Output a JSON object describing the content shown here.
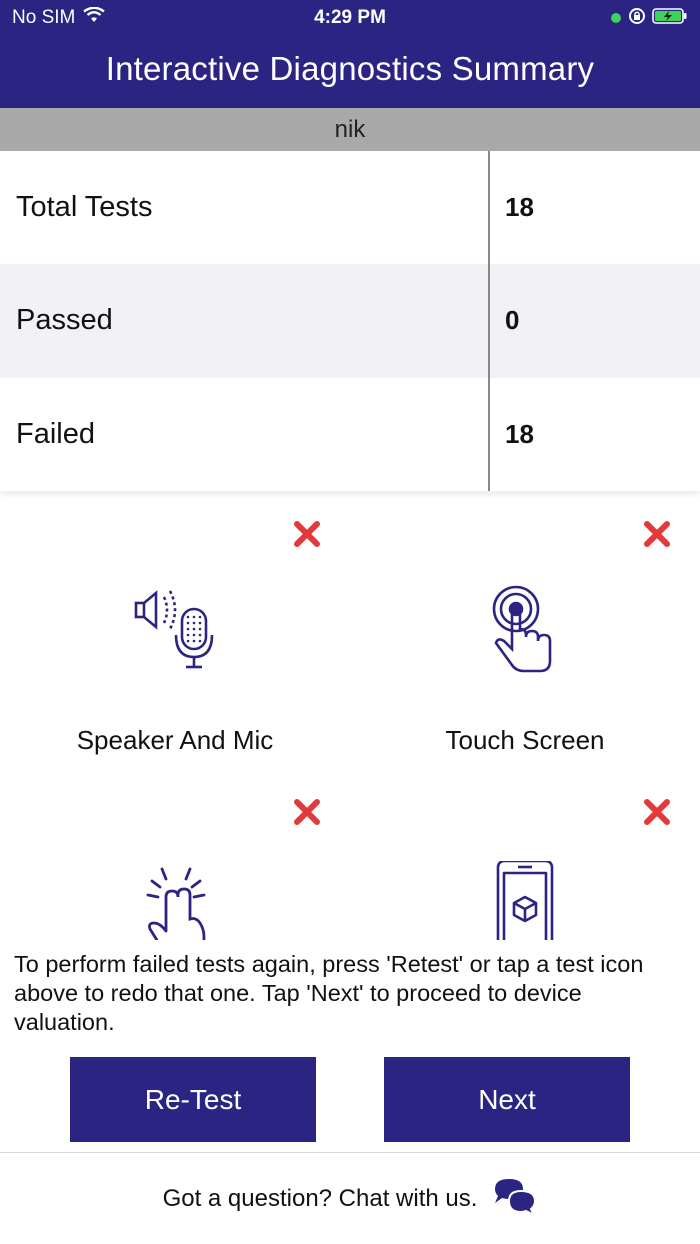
{
  "status_bar": {
    "carrier": "No SIM",
    "time": "4:29 PM"
  },
  "header": {
    "title": "Interactive Diagnostics Summary"
  },
  "user": {
    "name": "nik"
  },
  "summary": {
    "rows": [
      {
        "label": "Total Tests",
        "value": "18"
      },
      {
        "label": "Passed",
        "value": "0"
      },
      {
        "label": "Failed",
        "value": "18"
      }
    ]
  },
  "tests": [
    {
      "label": "Speaker And Mic",
      "icon": "speaker-mic-icon",
      "status": "failed"
    },
    {
      "label": "Touch Screen",
      "icon": "touch-screen-icon",
      "status": "failed"
    },
    {
      "label": "",
      "icon": "multi-touch-icon",
      "status": "failed"
    },
    {
      "label": "",
      "icon": "phone-ar-icon",
      "status": "failed"
    }
  ],
  "instructions": "To perform failed tests again, press 'Retest' or tap a test icon above to redo that one. Tap 'Next' to proceed to device valuation.",
  "buttons": {
    "retest_label": "Re-Test",
    "next_label": "Next"
  },
  "footer": {
    "chat_text": "Got a question? Chat with us."
  },
  "colors": {
    "brand": "#2b2483",
    "fail": "#e23a3a",
    "alt_row": "#f1f1f6",
    "user_bar": "#a9a9a9"
  }
}
